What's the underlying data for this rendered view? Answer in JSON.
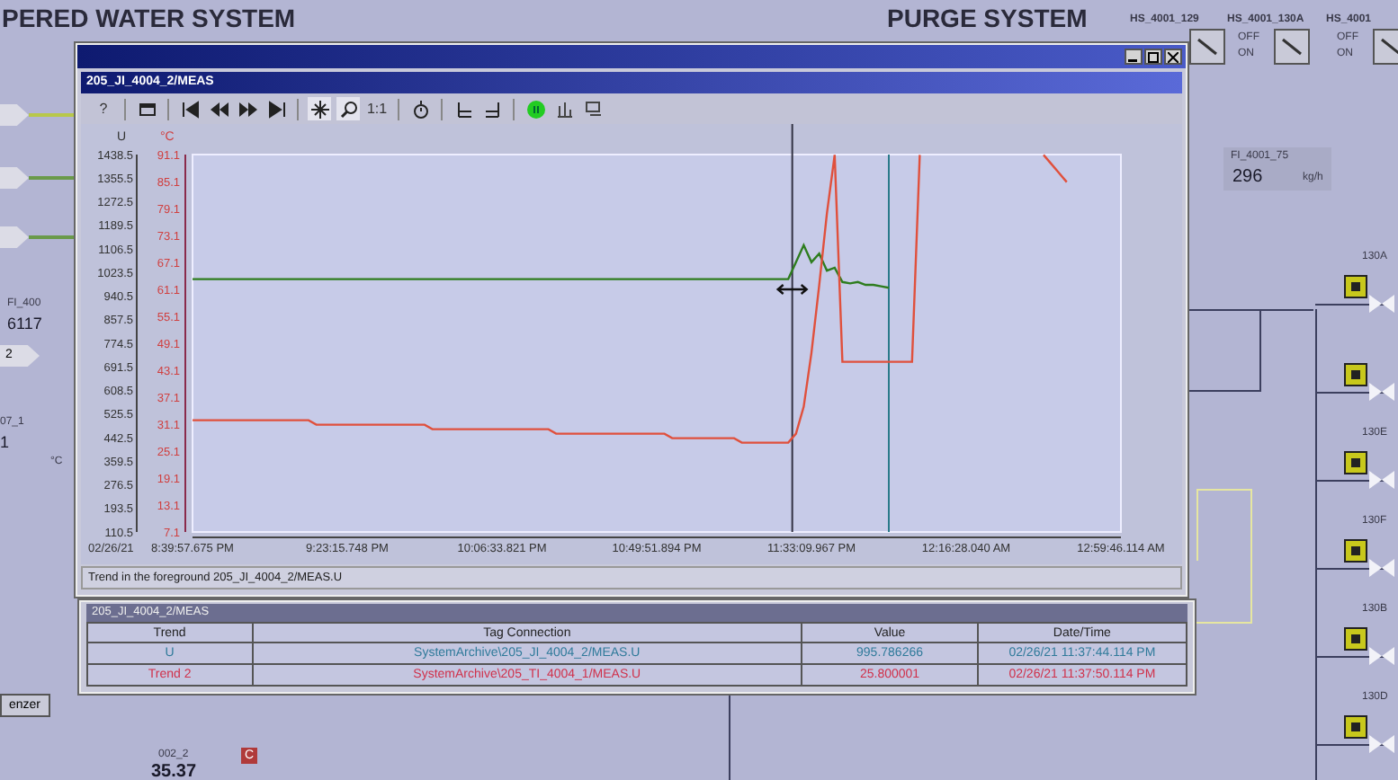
{
  "plant": {
    "title_left": "PERED WATER SYSTEM",
    "title_right": "PURGE SYSTEM",
    "switches": [
      {
        "tag": "HS_4001_129",
        "on": false
      },
      {
        "tag": "HS_4001_130A",
        "off": "OFF",
        "on_label": "ON",
        "on": false
      },
      {
        "tag": "HS_4001",
        "off": "OFF",
        "on_label": "ON",
        "on": false
      }
    ],
    "flow": {
      "tag": "FI_4001_75",
      "value": "296",
      "unit": "kg/h"
    },
    "left_flow": {
      "tag": "FI_400",
      "value": "6117"
    },
    "left_marker": "2",
    "left_temp": {
      "tag": "07_1",
      "value": "1",
      "unit": "°C"
    },
    "bottom_button": "enzer",
    "bottom_tag": {
      "tag": "002_2",
      "badge": "C",
      "value": "35.37"
    },
    "valves": [
      {
        "tag": "130A",
        "locked": true
      },
      {
        "locked": true
      },
      {
        "tag": "130E",
        "locked": true
      },
      {
        "tag": "130F",
        "locked": true
      },
      {
        "tag": "130B",
        "locked": true
      },
      {
        "tag": "130D",
        "locked": true
      }
    ]
  },
  "trend_window": {
    "title": "205_JI_4004_2/MEAS",
    "help_label": "?",
    "toolbar_text": "1:1",
    "start_date": "02/26/21",
    "plots": [
      {
        "chart_data": {
          "type": "line",
          "ylabel": "U",
          "ylim": [
            110.5,
            1438.5
          ],
          "categories": [
            "8:39:57.675 PM",
            null,
            null,
            null,
            null,
            null,
            null,
            null,
            null,
            null,
            null,
            null,
            null,
            null,
            null,
            null,
            null,
            null,
            null,
            null,
            "9:23:15.748 PM",
            null,
            null,
            null,
            null,
            null,
            null,
            null,
            null,
            null,
            null,
            null,
            null,
            null,
            null,
            null,
            null,
            null,
            null,
            null,
            "10:06:33.821 PM",
            null,
            null,
            null,
            null,
            null,
            null,
            null,
            null,
            null,
            null,
            null,
            null,
            null,
            null,
            null,
            null,
            null,
            null,
            null,
            "10:49:51.894 PM",
            null,
            null,
            null,
            null,
            null,
            null,
            null,
            null,
            null,
            null,
            null,
            null,
            null,
            null,
            null,
            null,
            null,
            null,
            null,
            "11:33:09.967 PM",
            null,
            null,
            null,
            null,
            null,
            null,
            null,
            null,
            null,
            null,
            null,
            null,
            null,
            null,
            null,
            null,
            null,
            null,
            null,
            "12:16:28.040 AM",
            null,
            null,
            null,
            null,
            null,
            null,
            null,
            null,
            null,
            null,
            null,
            null,
            null,
            null,
            null,
            null,
            null,
            null,
            null,
            "12:59:46.114 AM"
          ],
          "yticks": [
            110.5,
            193.5,
            276.5,
            359.5,
            442.5,
            525.5,
            608.5,
            691.5,
            774.5,
            857.5,
            940.5,
            1023.5,
            1106.5,
            1189.5,
            1272.5,
            1355.5,
            1438.5
          ],
          "series": [
            {
              "color": "#2e7d1e",
              "values": [
                1000,
                1000,
                1000,
                1000,
                1000,
                1000,
                1000,
                1000,
                1000,
                1000,
                1000,
                1000,
                1000,
                1000,
                1000,
                1000,
                1000,
                1000,
                1000,
                1000,
                1000,
                1000,
                1000,
                1000,
                1000,
                1000,
                1000,
                1000,
                1000,
                1000,
                1000,
                1000,
                1000,
                1000,
                1000,
                1000,
                1000,
                1000,
                1000,
                1000,
                1000,
                1000,
                1000,
                1000,
                1000,
                1000,
                1000,
                1000,
                1000,
                1000,
                1000,
                1000,
                1000,
                1000,
                1000,
                1000,
                1000,
                1000,
                1000,
                1000,
                1000,
                1000,
                1000,
                1000,
                1000,
                1000,
                1000,
                1000,
                1000,
                1000,
                1000,
                1000,
                1000,
                1000,
                1000,
                1000,
                1000,
                1000,
                1060,
                1120,
                1060,
                1090,
                1030,
                1040,
                990,
                985,
                990,
                980,
                980,
                975,
                970,
                null,
                null,
                null,
                null,
                null,
                null,
                null,
                null,
                null,
                null,
                null,
                null,
                null,
                null,
                null,
                null,
                null,
                null,
                null,
                null,
                null,
                null,
                null,
                null,
                null,
                null,
                null,
                null,
                null,
                null
              ]
            }
          ]
        }
      },
      {
        "chart_data": {
          "type": "line",
          "ylabel": "°C",
          "ylim": [
            7.1,
            91.1
          ],
          "yticks": [
            7.1,
            13.1,
            19.1,
            25.1,
            31.1,
            37.1,
            43.1,
            49.1,
            55.1,
            61.1,
            67.1,
            73.1,
            79.1,
            85.1,
            91.1
          ],
          "series": [
            {
              "color": "#e0503c",
              "values": [
                32,
                32,
                32,
                32,
                32,
                32,
                32,
                32,
                32,
                32,
                32,
                32,
                32,
                32,
                32,
                32,
                31,
                31,
                31,
                31,
                31,
                31,
                31,
                31,
                31,
                31,
                31,
                31,
                31,
                31,
                31,
                30,
                30,
                30,
                30,
                30,
                30,
                30,
                30,
                30,
                30,
                30,
                30,
                30,
                30,
                30,
                30,
                29,
                29,
                29,
                29,
                29,
                29,
                29,
                29,
                29,
                29,
                29,
                29,
                29,
                29,
                29,
                28,
                28,
                28,
                28,
                28,
                28,
                28,
                28,
                28,
                27,
                27,
                27,
                27,
                27,
                27,
                27,
                29,
                35,
                47,
                62,
                78,
                91,
                45,
                45,
                45,
                45,
                45,
                45,
                45,
                45,
                45,
                45,
                91,
                null,
                null,
                null,
                null,
                null,
                null,
                null,
                null,
                null,
                null,
                null,
                null,
                null,
                null,
                null,
                91,
                89,
                87,
                85,
                null,
                null,
                null,
                null,
                null,
                null,
                null
              ]
            }
          ]
        }
      }
    ],
    "status": "Trend in the foreground 205_JI_4004_2/MEAS.U"
  },
  "table_window": {
    "title": "205_JI_4004_2/MEAS",
    "columns": [
      "Trend",
      "Tag Connection",
      "Value",
      "Date/Time"
    ],
    "rows": [
      {
        "trend": "U",
        "tag": "SystemArchive\\205_JI_4004_2/MEAS.U",
        "value": "995.786266",
        "time": "02/26/21 11:37:44.114 PM",
        "color": "#2f7a9a"
      },
      {
        "trend": "Trend 2",
        "tag": "SystemArchive\\205_TI_4004_1/MEAS.U",
        "value": "25.800001",
        "time": "02/26/21 11:37:50.114 PM",
        "color": "#d0304a"
      }
    ]
  }
}
